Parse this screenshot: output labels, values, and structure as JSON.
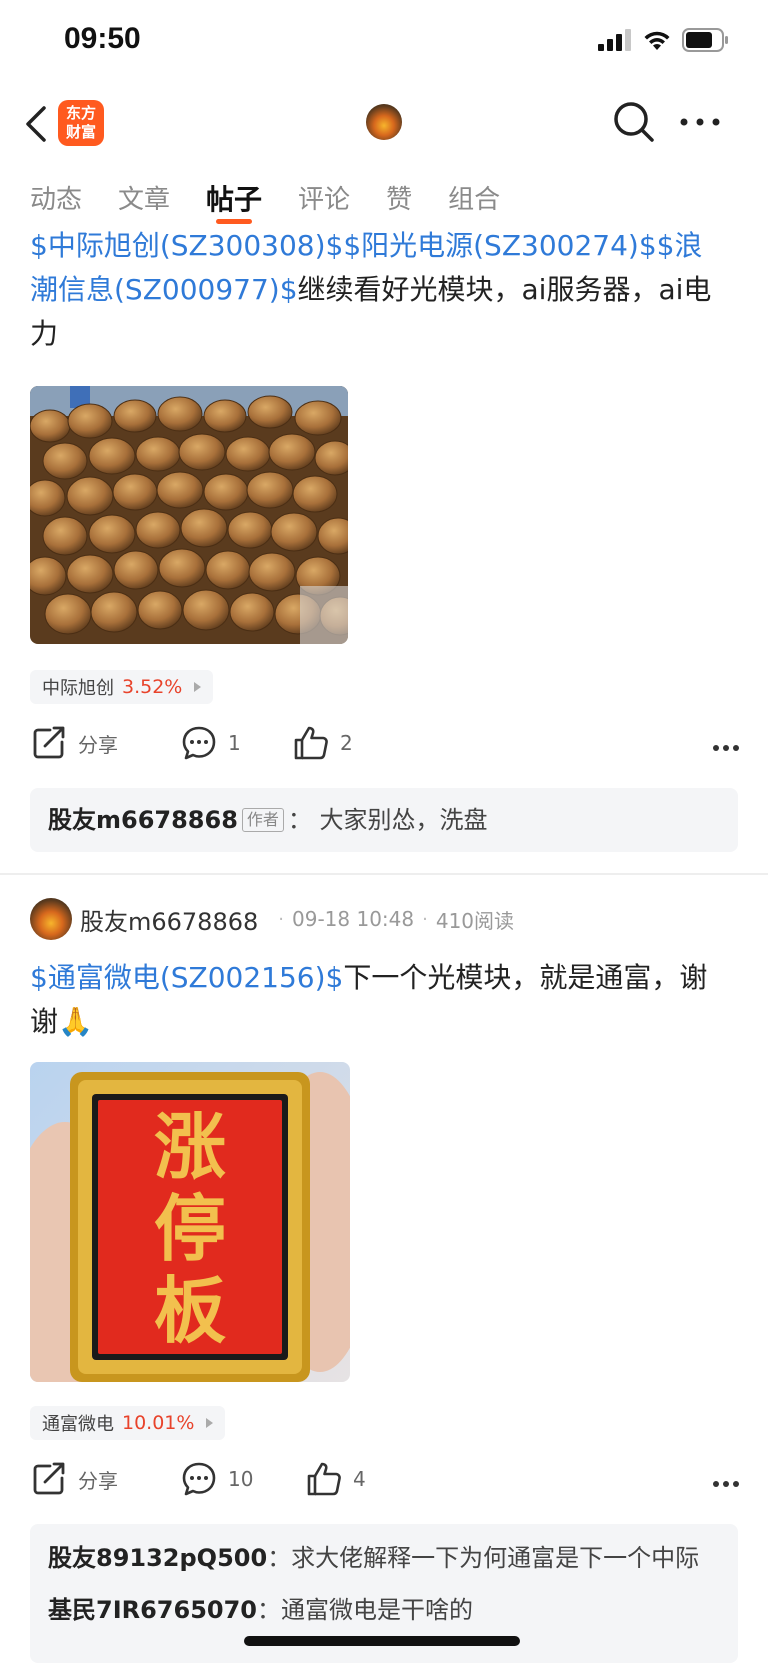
{
  "status_bar": {
    "time": "09:50"
  },
  "nav": {
    "logo_text_1": "东方",
    "logo_text_2": "财富"
  },
  "tabs": [
    {
      "label": "动态"
    },
    {
      "label": "文章"
    },
    {
      "label": "帖子"
    },
    {
      "label": "评论"
    },
    {
      "label": "赞"
    },
    {
      "label": "组合"
    }
  ],
  "posts": [
    {
      "text_links_1": "$中际旭创(SZ300308)$$阳光电源(SZ300274)$$浪潮信息(SZ000977)$",
      "text_rest": "继续看好光模块，ai服务器，ai电力",
      "stock_chip": {
        "name": "中际旭创",
        "change": "3.52%"
      },
      "share_label": "分享",
      "comments_count": "1",
      "likes_count": "2",
      "top_comment": {
        "author": "股友m6678868",
        "author_tag": "作者",
        "text": "：  大家别怂，洗盘"
      }
    },
    {
      "author": "股友m6678868",
      "date": "09-18 10:48",
      "reads": "410阅读",
      "text_link": "$通富微电(SZ002156)$",
      "text_rest": "下一个光模块，就是通富，谢谢🙏",
      "image_text": [
        "涨",
        "停",
        "板"
      ],
      "stock_chip": {
        "name": "通富微电",
        "change": "10.01%"
      },
      "share_label": "分享",
      "comments_count": "10",
      "likes_count": "4",
      "comments": [
        {
          "author": "股友89132pQ500",
          "text": "：求大佬解释一下为何通富是下一个中际"
        },
        {
          "author": "基民7IR6765070",
          "text": "：通富微电是干啥的"
        }
      ]
    }
  ]
}
